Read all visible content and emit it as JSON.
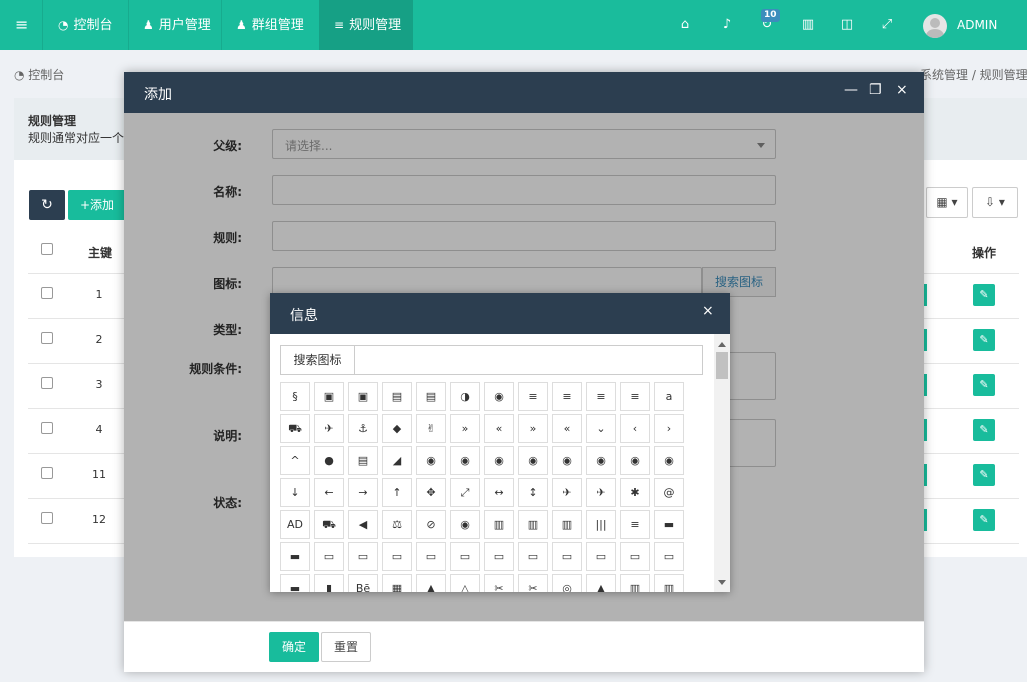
{
  "topbar": {
    "toggle_icon": "≡",
    "items": [
      {
        "icon": "dashboard-icon",
        "glyph": "◔",
        "label": "控制台"
      },
      {
        "icon": "user-icon",
        "glyph": "♟",
        "label": "用户管理"
      },
      {
        "icon": "users-icon",
        "glyph": "♟",
        "label": "群组管理"
      },
      {
        "icon": "list-icon",
        "glyph": "≡",
        "label": "规则管理"
      }
    ],
    "right_icons": [
      {
        "icon": "home-icon",
        "glyph": "⌂"
      },
      {
        "icon": "bell-icon",
        "glyph": "♪"
      },
      {
        "icon": "refresh-icon",
        "glyph": "↻"
      },
      {
        "icon": "trash-icon",
        "glyph": "▥"
      },
      {
        "icon": "language-icon",
        "glyph": "◫"
      },
      {
        "icon": "fullscreen-icon",
        "glyph": "⤢"
      }
    ],
    "badge": "10",
    "user": "ADMIN",
    "accent": "#1abc9c"
  },
  "breadcrumb": {
    "left": "控制台",
    "right": "系统管理  /  规则管理"
  },
  "panel": {
    "title": "规则管理",
    "desc": "规则通常对应一个"
  },
  "toolbar": {
    "add_label": "+添加",
    "refresh_glyph": "↻",
    "columns_glyph": "▦ ▾",
    "export_glyph": "⇩ ▾"
  },
  "table": {
    "col_pk": "主键",
    "col_action": "操作",
    "rows": [
      "1",
      "2",
      "3",
      "4",
      "11",
      "12"
    ]
  },
  "modal": {
    "title": "添加",
    "min": "—",
    "max": "❐",
    "close": "×",
    "labels": {
      "parent": "父级:",
      "name": "名称:",
      "rule": "规则:",
      "icon": "图标:",
      "type": "类型:",
      "condition": "规则条件:",
      "remark": "说明:",
      "status": "状态:"
    },
    "parent_placeholder": "请选择...",
    "icon_search_btn": "搜索图标",
    "ok": "确定",
    "reset": "重置"
  },
  "dialog": {
    "title": "信息",
    "close": "×",
    "search_label": "搜索图标",
    "icons": [
      "§",
      "▣",
      "▣",
      "▤",
      "▤",
      "◑",
      "◉",
      "≡",
      "≡",
      "≡",
      "≡",
      "a",
      "⛟",
      "✈",
      "⚓",
      "◆",
      "✌",
      "»",
      "«",
      "»",
      "«",
      "⌄",
      "‹",
      "›",
      "^",
      "●",
      "▤",
      "◢",
      "◉",
      "◉",
      "◉",
      "◉",
      "◉",
      "◉",
      "◉",
      "◉",
      "↓",
      "←",
      "→",
      "↑",
      "✥",
      "⤢",
      "↔",
      "↕",
      "✈",
      "✈",
      "✱",
      "@",
      "AD",
      "⛟",
      "◀",
      "⚖",
      "⊘",
      "◉",
      "▥",
      "▥",
      "▥",
      "|||",
      "≡",
      "▬",
      "▬",
      "▭",
      "▭",
      "▭",
      "▭",
      "▭",
      "▭",
      "▭",
      "▭",
      "▭",
      "▭",
      "▭",
      "▬",
      "▮",
      "Bē",
      "▦",
      "▲",
      "△",
      "✂",
      "✂",
      "◎",
      "▲",
      "▥",
      "▥"
    ]
  }
}
